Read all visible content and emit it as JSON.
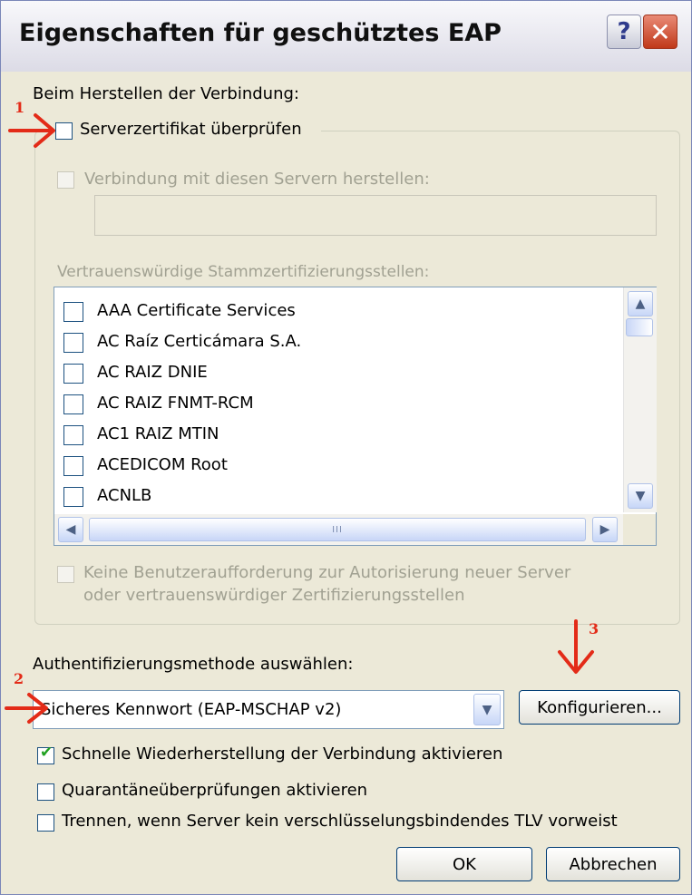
{
  "window": {
    "title": "Eigenschaften für geschütztes EAP"
  },
  "titlebar": {
    "help_glyph": "?",
    "close_glyph": "✕"
  },
  "connect": {
    "heading": "Beim Herstellen der Verbindung:",
    "verify_cert": {
      "label": "Serverzertifikat überprüfen",
      "checked": false
    },
    "connect_servers": {
      "label": "Verbindung mit diesen Servern herstellen:",
      "checked": false,
      "enabled": false,
      "value": ""
    },
    "root_ca_heading": "Vertrauenswürdige Stammzertifizierungsstellen:",
    "root_cas": [
      {
        "name": "AAA Certificate Services",
        "checked": false
      },
      {
        "name": "AC Raíz Certicámara S.A.",
        "checked": false
      },
      {
        "name": "AC RAIZ DNIE",
        "checked": false
      },
      {
        "name": "AC RAIZ FNMT-RCM",
        "checked": false
      },
      {
        "name": "AC1 RAIZ MTIN",
        "checked": false
      },
      {
        "name": "ACEDICOM Root",
        "checked": false
      },
      {
        "name": "ACNLB",
        "checked": false
      }
    ],
    "no_prompt": {
      "line1": "Keine Benutzeraufforderung zur Autorisierung neuer Server",
      "line2": "oder vertrauenswürdiger Zertifizierungsstellen",
      "checked": false,
      "enabled": false
    }
  },
  "auth": {
    "heading": "Authentifizierungsmethode auswählen:",
    "selected": "Sicheres Kennwort (EAP-MSCHAP v2)",
    "configure_label": "Konfigurieren..."
  },
  "options": [
    {
      "label": "Schnelle Wiederherstellung der Verbindung aktivieren",
      "checked": true
    },
    {
      "label": "Quarantäneüberprüfungen aktivieren",
      "checked": false
    },
    {
      "label": "Trennen, wenn Server kein verschlüsselungsbindendes TLV vorweist",
      "checked": false
    }
  ],
  "buttons": {
    "ok": "OK",
    "cancel": "Abbrechen"
  },
  "annotations": {
    "marker1": "1",
    "marker2": "2",
    "marker3": "3",
    "color": "#e32b18"
  },
  "icons": {
    "scroll_up": "▲",
    "scroll_down": "▼",
    "scroll_left": "◀",
    "scroll_right": "▶",
    "grip": "III",
    "check": "✔"
  }
}
